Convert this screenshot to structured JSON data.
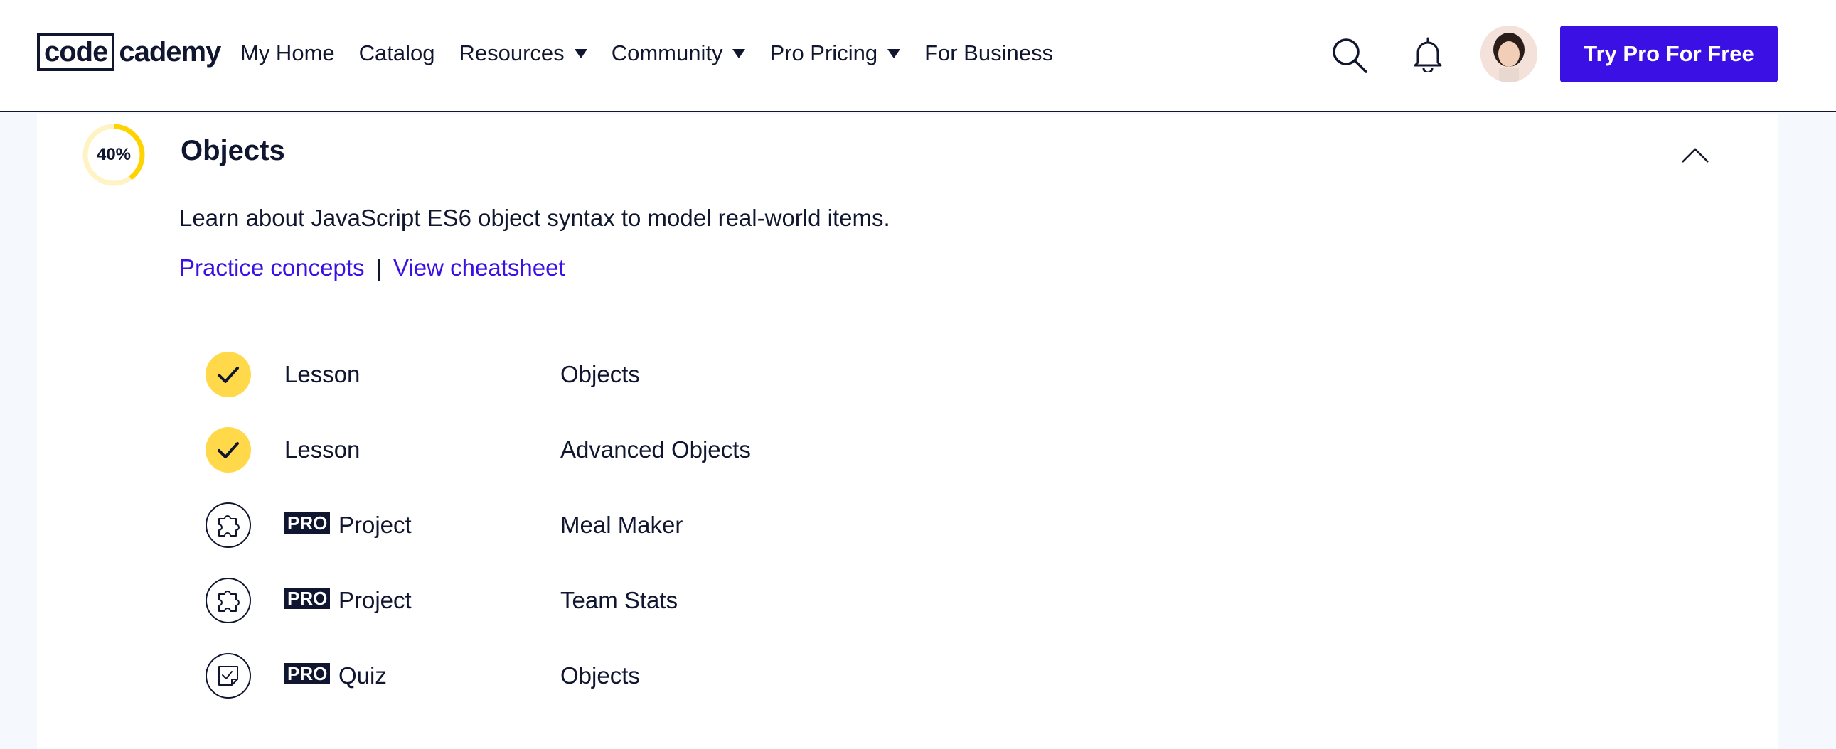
{
  "header": {
    "logo": {
      "part1": "code",
      "part2": "cademy"
    },
    "nav": [
      {
        "label": "My Home",
        "dropdown": false
      },
      {
        "label": "Catalog",
        "dropdown": false
      },
      {
        "label": "Resources",
        "dropdown": true
      },
      {
        "label": "Community",
        "dropdown": true
      },
      {
        "label": "Pro Pricing",
        "dropdown": true
      },
      {
        "label": "For Business",
        "dropdown": false
      }
    ],
    "icons": [
      "search-icon",
      "bell-icon"
    ],
    "cta_label": "Try Pro For Free"
  },
  "module": {
    "progress_label": "40%",
    "progress_fraction": 0.4,
    "title": "Objects",
    "description": "Learn about JavaScript ES6 object syntax to model real-world items.",
    "links": {
      "practice": "Practice concepts",
      "separator": "|",
      "cheatsheet": "View cheatsheet"
    },
    "items": [
      {
        "status": "complete",
        "pro": false,
        "type": "Lesson",
        "name": "Objects",
        "icon": "check-icon"
      },
      {
        "status": "complete",
        "pro": false,
        "type": "Lesson",
        "name": "Advanced Objects",
        "icon": "check-icon"
      },
      {
        "status": "incomplete",
        "pro": true,
        "pro_label": "PRO",
        "type": "Project",
        "name": "Meal Maker",
        "icon": "puzzle-icon"
      },
      {
        "status": "incomplete",
        "pro": true,
        "pro_label": "PRO",
        "type": "Project",
        "name": "Team Stats",
        "icon": "puzzle-icon"
      },
      {
        "status": "incomplete",
        "pro": true,
        "pro_label": "PRO",
        "type": "Quiz",
        "name": "Objects",
        "icon": "quiz-icon"
      }
    ]
  },
  "colors": {
    "accent": "#3a10e5",
    "ink": "#10162f",
    "progress": "#ffd300",
    "progress_track": "#fff3c4",
    "check_fill": "#ffd94a"
  }
}
